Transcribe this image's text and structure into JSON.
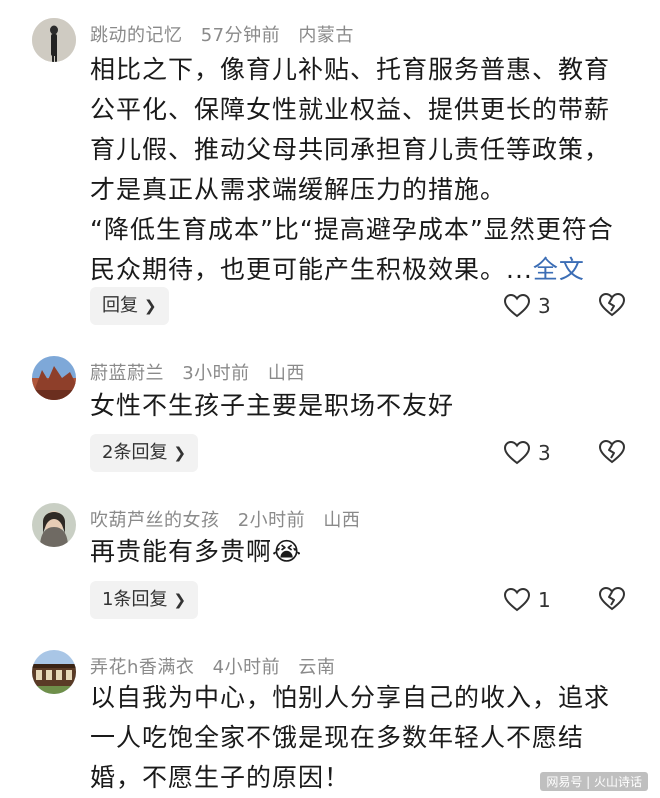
{
  "comments": [
    {
      "username": "跳动的记忆",
      "time": "57分钟前",
      "location": "内蒙古",
      "paragraphs": [
        "相比之下，像育儿补贴、托育服务普惠、教育公平化、保障女性就业权益、提供更长的带薪育儿假、推动父母共同承担育儿责任等政策，才是真正从需求端缓解压力的措施。",
        "“降低生育成本”比“提高避孕成本”显然更符合民众期待，也更可能产生积极效果。..."
      ],
      "full_text_link": "全文",
      "reply_label": "回复",
      "likes": "3"
    },
    {
      "username": "蔚蓝蔚兰",
      "time": "3小时前",
      "location": "山西",
      "text": "女性不生孩子主要是职场不友好",
      "reply_label": "2条回复",
      "likes": "3"
    },
    {
      "username": "吹葫芦丝的女孩",
      "time": "2小时前",
      "location": "山西",
      "text": "再贵能有多贵啊",
      "emoji": "😭",
      "reply_label": "1条回复",
      "likes": "1"
    },
    {
      "username": "弄花h香满衣",
      "time": "4小时前",
      "location": "云南",
      "text": "以自我为中心，怕别人分享自己的收入，追求一人吃饱全家不饿是现在多数年轻人不愿结婚，不愿生子的原因！"
    }
  ],
  "watermark": "网易号 | 火山诗话",
  "icons": {
    "like": "heart-outline-icon",
    "dislike": "broken-heart-icon",
    "chevron": "chevron-right-icon"
  },
  "colors": {
    "link": "#3b6db5",
    "meta": "#8a8a8a",
    "reply_bg": "#f2f2f2"
  }
}
